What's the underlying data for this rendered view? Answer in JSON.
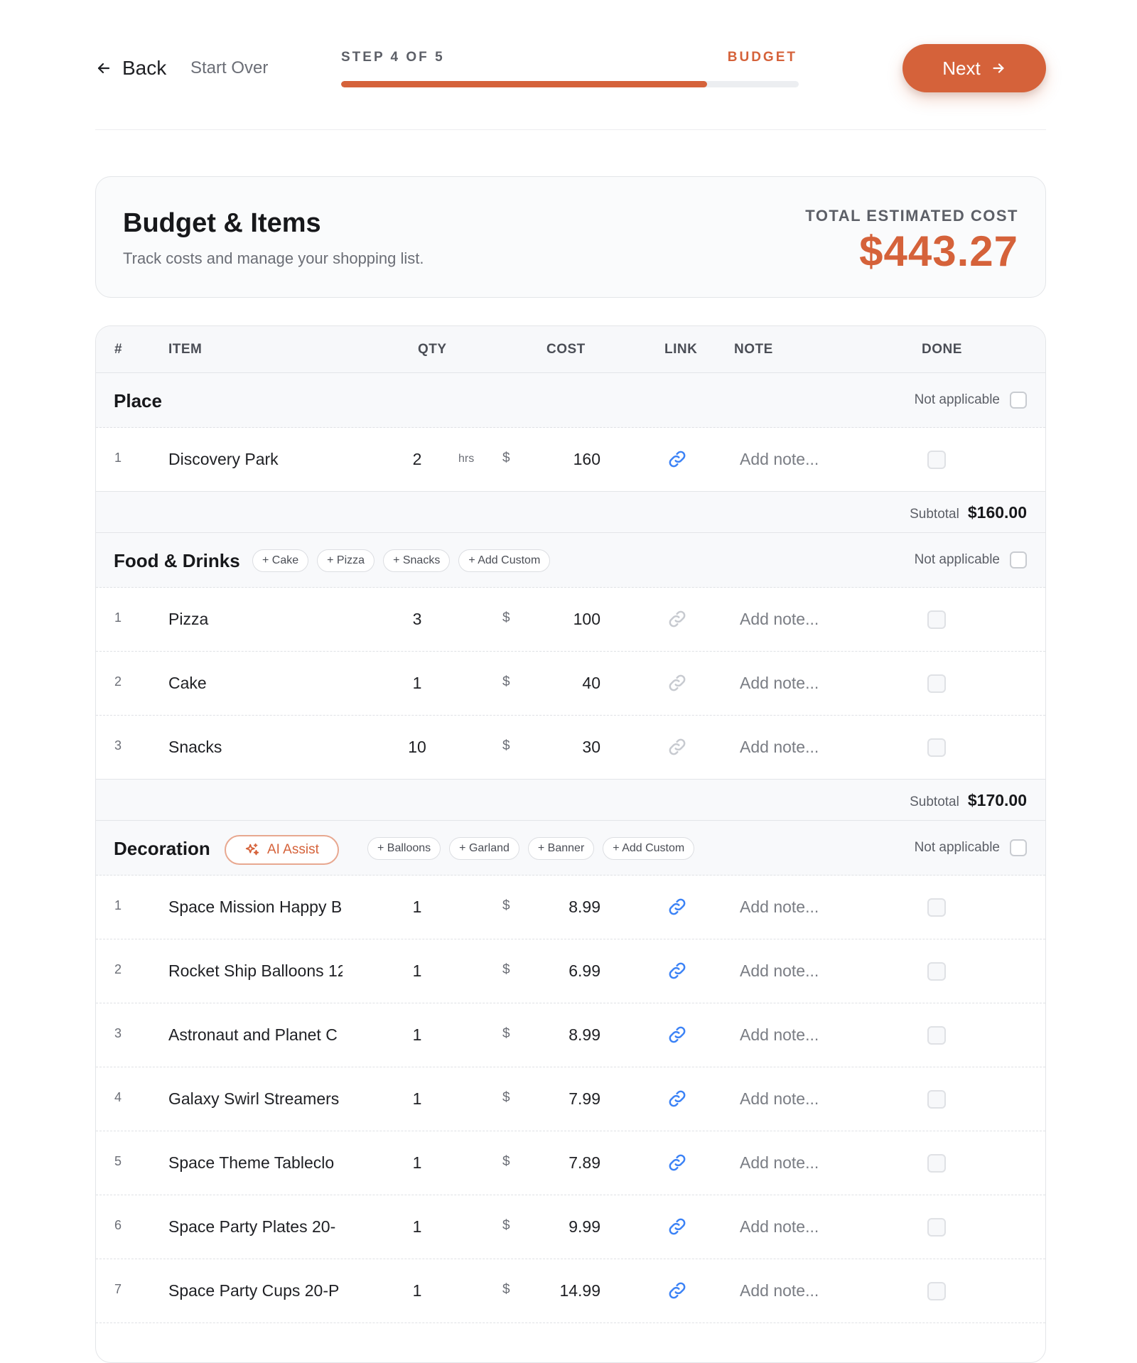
{
  "nav": {
    "back_label": "Back",
    "start_over_label": "Start Over",
    "step_label": "STEP 4 OF 5",
    "step_name": "BUDGET",
    "progress_fraction": 0.8,
    "next_label": "Next"
  },
  "header": {
    "title": "Budget & Items",
    "subtitle": "Track costs and manage your shopping list.",
    "total_label": "TOTAL ESTIMATED COST",
    "total_value": "$443.27"
  },
  "table": {
    "columns": [
      "#",
      "ITEM",
      "QTY",
      "COST",
      "LINK",
      "NOTE",
      "DONE"
    ],
    "not_applicable_label": "Not applicable",
    "note_placeholder": "Add note...",
    "subtotal_label": "Subtotal",
    "currency_symbol": "$",
    "categories": [
      {
        "title": "Place",
        "chips": [],
        "subtotal": "$160.00",
        "items": [
          {
            "num": "1",
            "name": "Discovery Park",
            "qty": "2",
            "unit": "hrs",
            "cost": "160",
            "link_active": true
          }
        ]
      },
      {
        "title": "Food & Drinks",
        "chips": [
          "+ Cake",
          "+ Pizza",
          "+ Snacks",
          "+ Add Custom"
        ],
        "subtotal": "$170.00",
        "items": [
          {
            "num": "1",
            "name": "Pizza",
            "qty": "3",
            "unit": "",
            "cost": "100",
            "link_active": false
          },
          {
            "num": "2",
            "name": "Cake",
            "qty": "1",
            "unit": "",
            "cost": "40",
            "link_active": false
          },
          {
            "num": "3",
            "name": "Snacks",
            "qty": "10",
            "unit": "",
            "cost": "30",
            "link_active": false
          }
        ]
      },
      {
        "title": "Decoration",
        "ai_label": "AI Assist",
        "chips": [
          "+ Balloons",
          "+ Garland",
          "+ Banner",
          "+ Add Custom"
        ],
        "items": [
          {
            "num": "1",
            "name": "Space Mission Happy B",
            "qty": "1",
            "unit": "",
            "cost": "8.99",
            "link_active": true
          },
          {
            "num": "2",
            "name": "Rocket Ship Balloons 12",
            "qty": "1",
            "unit": "",
            "cost": "6.99",
            "link_active": true
          },
          {
            "num": "3",
            "name": "Astronaut and Planet C",
            "qty": "1",
            "unit": "",
            "cost": "8.99",
            "link_active": true
          },
          {
            "num": "4",
            "name": "Galaxy Swirl Streamers",
            "qty": "1",
            "unit": "",
            "cost": "7.99",
            "link_active": true
          },
          {
            "num": "5",
            "name": "Space Theme Tableclo",
            "qty": "1",
            "unit": "",
            "cost": "7.89",
            "link_active": true
          },
          {
            "num": "6",
            "name": "Space Party Plates 20-",
            "qty": "1",
            "unit": "",
            "cost": "9.99",
            "link_active": true
          },
          {
            "num": "7",
            "name": "Space Party Cups 20-P",
            "qty": "1",
            "unit": "",
            "cost": "14.99",
            "link_active": true
          }
        ]
      }
    ]
  },
  "colors": {
    "accent": "#d5623a",
    "link_active": "#3b82f6",
    "link_inactive": "#c7cad0"
  }
}
